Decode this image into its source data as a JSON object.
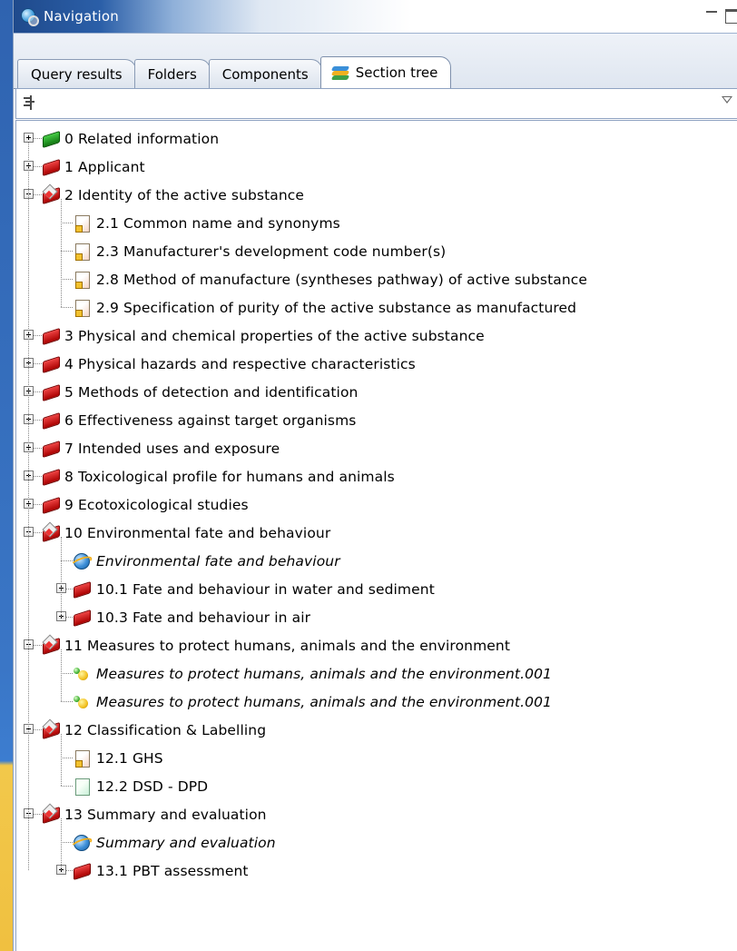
{
  "window": {
    "title": "Navigation",
    "icon": "navigation-globe-icon"
  },
  "tabs": [
    {
      "label": "Query results",
      "active": false
    },
    {
      "label": "Folders",
      "active": false
    },
    {
      "label": "Components",
      "active": false
    },
    {
      "label": "Section tree",
      "active": true,
      "icon": "section-tree-stack-icon"
    }
  ],
  "filter": {
    "icon": "filter-toggle-icon",
    "dropdown_icon": "dropdown-arrow-icon"
  },
  "tree": [
    {
      "label": "0 Related information",
      "level": 0,
      "toggle": "plus",
      "icon": "green-book-icon"
    },
    {
      "label": "1 Applicant",
      "level": 0,
      "toggle": "plus",
      "icon": "red-book-icon"
    },
    {
      "label": "2 Identity of the active substance",
      "level": 0,
      "toggle": "minus",
      "icon": "red-book-marker-icon"
    },
    {
      "label": "2.1 Common name and synonyms",
      "level": 1,
      "icon": "warning-document-icon"
    },
    {
      "label": "2.3 Manufacturer's development code number(s)",
      "level": 1,
      "icon": "warning-document-icon"
    },
    {
      "label": "2.8 Method of manufacture (syntheses pathway) of active substance",
      "level": 1,
      "icon": "warning-document-icon"
    },
    {
      "label": "2.9 Specification of purity of the active substance as manufactured",
      "level": 1,
      "icon": "warning-document-icon"
    },
    {
      "label": "3 Physical and chemical properties of the active substance",
      "level": 0,
      "toggle": "plus",
      "icon": "red-book-icon"
    },
    {
      "label": "4 Physical hazards and respective characteristics",
      "level": 0,
      "toggle": "plus",
      "icon": "red-book-icon"
    },
    {
      "label": "5 Methods of detection and identification",
      "level": 0,
      "toggle": "plus",
      "icon": "red-book-icon"
    },
    {
      "label": "6 Effectiveness against target organisms",
      "level": 0,
      "toggle": "plus",
      "icon": "red-book-icon"
    },
    {
      "label": "7 Intended uses and exposure",
      "level": 0,
      "toggle": "plus",
      "icon": "red-book-icon"
    },
    {
      "label": "8 Toxicological profile for humans and animals",
      "level": 0,
      "toggle": "plus",
      "icon": "red-book-icon"
    },
    {
      "label": "9 Ecotoxicological studies",
      "level": 0,
      "toggle": "plus",
      "icon": "red-book-icon"
    },
    {
      "label": "10 Environmental fate and behaviour",
      "level": 0,
      "toggle": "minus",
      "icon": "red-book-marker-icon"
    },
    {
      "label": "Environmental fate and behaviour",
      "level": 1,
      "icon": "endpoint-globe-icon",
      "italic": true
    },
    {
      "label": "10.1 Fate and behaviour in water and sediment",
      "level": 1,
      "toggle": "plus",
      "icon": "red-book-icon"
    },
    {
      "label": "10.3 Fate and behaviour in air",
      "level": 1,
      "toggle": "plus",
      "icon": "red-book-icon"
    },
    {
      "label": "11 Measures to protect humans, animals and the environment",
      "level": 0,
      "toggle": "minus",
      "icon": "red-book-marker-icon"
    },
    {
      "label": "Measures to protect humans, animals and the environment.001",
      "level": 1,
      "icon": "measures-dots-icon",
      "italic": true
    },
    {
      "label": "Measures to protect humans, animals and the environment.001",
      "level": 1,
      "icon": "measures-dots-icon",
      "italic": true
    },
    {
      "label": "12 Classification & Labelling",
      "level": 0,
      "toggle": "minus",
      "icon": "red-book-marker-icon"
    },
    {
      "label": "12.1 GHS",
      "level": 1,
      "icon": "warning-document-icon"
    },
    {
      "label": "12.2 DSD - DPD",
      "level": 1,
      "icon": "mint-document-icon"
    },
    {
      "label": "13 Summary and evaluation",
      "level": 0,
      "toggle": "minus",
      "icon": "red-book-marker-icon"
    },
    {
      "label": "Summary and evaluation",
      "level": 1,
      "icon": "endpoint-globe-icon",
      "italic": true
    },
    {
      "label": "13.1 PBT assessment",
      "level": 1,
      "toggle": "plus",
      "icon": "red-book-icon"
    }
  ]
}
